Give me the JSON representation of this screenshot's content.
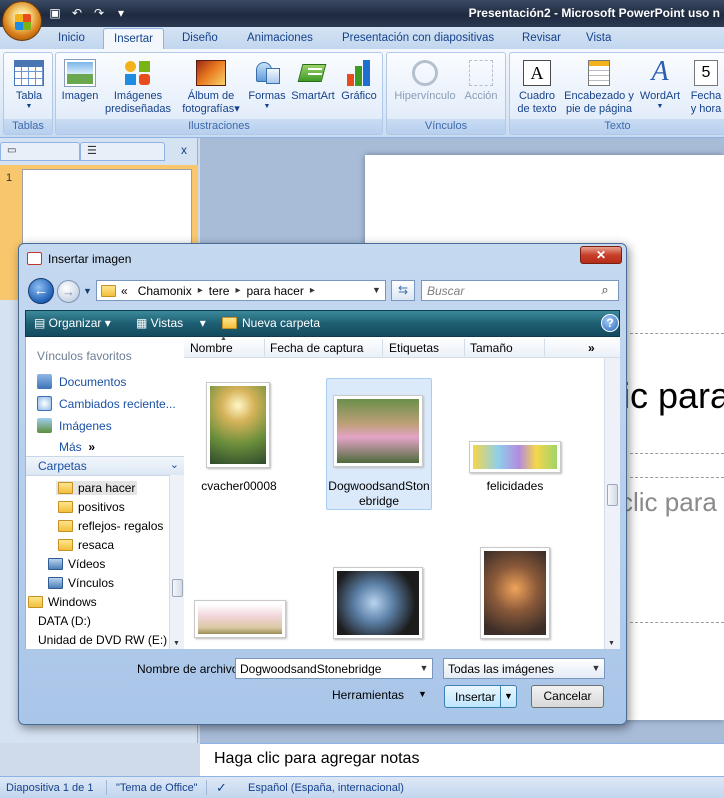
{
  "window": {
    "title": "Presentación2 - Microsoft PowerPoint uso n"
  },
  "quick_access": {
    "save_icon": "save-icon",
    "undo_icon": "undo-icon",
    "redo_icon": "redo-icon"
  },
  "tabs": [
    "Inicio",
    "Insertar",
    "Diseño",
    "Animaciones",
    "Presentación con diapositivas",
    "Revisar",
    "Vista"
  ],
  "active_tab": "Insertar",
  "ribbon": {
    "groups": {
      "tablas": "Tablas",
      "ilustraciones": "Ilustraciones",
      "vinculos": "Vínculos",
      "texto": "Texto"
    },
    "buttons": {
      "tabla": "Tabla",
      "imagen": "Imagen",
      "imagenes_predis_1": "Imágenes",
      "imagenes_predis_2": "prediseñadas",
      "album_1": "Álbum de",
      "album_2": "fotografías",
      "formas": "Formas",
      "smartart": "SmartArt",
      "grafico": "Gráfico",
      "hipervinculo": "Hipervínculo",
      "accion": "Acción",
      "cuadro_1": "Cuadro",
      "cuadro_2": "de texto",
      "encabezado_1": "Encabezado y",
      "encabezado_2": "pie de página",
      "wordart": "WordArt",
      "fecha_1": "Fecha",
      "fecha_2": "y hora"
    }
  },
  "slides_pane": {
    "slide_number": "1",
    "close": "x"
  },
  "slide": {
    "title_placeholder": "ic para",
    "subtitle_placeholder": "clic para"
  },
  "notes": {
    "placeholder": "Haga clic para agregar notas"
  },
  "statusbar": {
    "slide_info": "Diapositiva 1 de 1",
    "theme": "\"Tema de Office\"",
    "language": "Español (España, internacional)"
  },
  "dialog": {
    "title": "Insertar imagen",
    "address": {
      "prefix": "«",
      "crumbs": [
        "Chamonix",
        "tere",
        "para hacer"
      ]
    },
    "search_placeholder": "Buscar",
    "toolbar": {
      "organizar": "Organizar",
      "vistas": "Vistas",
      "nueva_carpeta": "Nueva carpeta",
      "help": "?"
    },
    "favorites_title": "Vínculos favoritos",
    "favorites": [
      "Documentos",
      "Cambiados reciente...",
      "Imágenes",
      "Más"
    ],
    "favorites_more_arrows": "»",
    "folders_title": "Carpetas",
    "tree": [
      "para hacer",
      "positivos",
      "reflejos- regalos",
      "resaca",
      "Vídeos",
      "Vínculos",
      "Windows",
      "DATA (D:)",
      "Unidad de DVD RW (E:)"
    ],
    "columns": [
      "Nombre",
      "Fecha de captura",
      "Etiquetas",
      "Tamaño"
    ],
    "columns_more": "»",
    "files": [
      {
        "name": "cvacher00008"
      },
      {
        "name_line1": "DogwoodsandSton",
        "name_line2": "ebridge"
      },
      {
        "name": "felicidades"
      }
    ],
    "filename_label": "Nombre de archivo:",
    "filename_value": "DogwoodsandStonebridge",
    "filter_value": "Todas las imágenes",
    "tools_label": "Herramientas",
    "insert_label": "Insertar",
    "cancel_label": "Cancelar"
  },
  "colors": {
    "ribbon_blue": "#15428b",
    "dialog_toolbar": "#1e5e72",
    "selection": "#dbeafb"
  }
}
